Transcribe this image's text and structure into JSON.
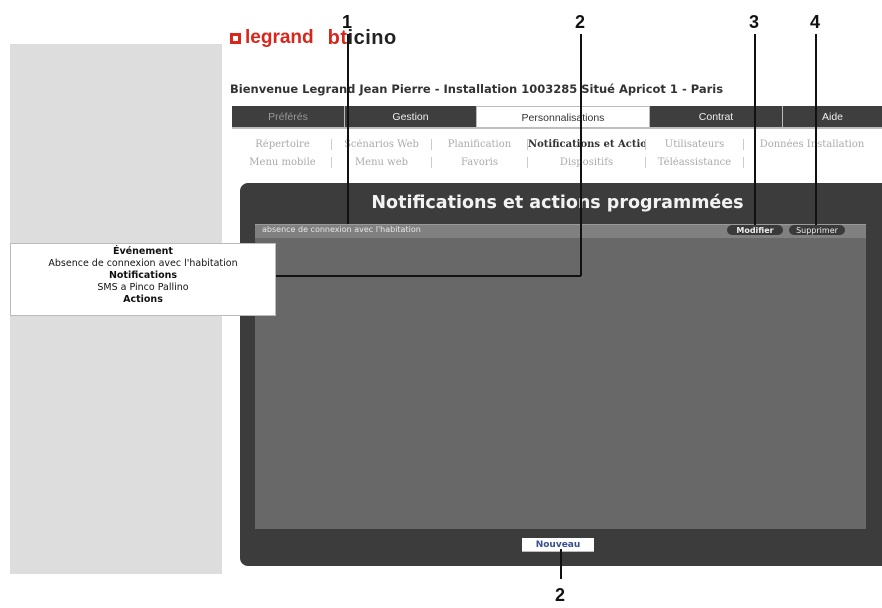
{
  "brand": {
    "legrand": "legrand",
    "bticino": "bticino"
  },
  "welcome": "Bienvenue Legrand Jean Pierre - Installation 1003285 Situé Apricot 1 - Paris",
  "main_tabs": [
    {
      "label": "Préférés"
    },
    {
      "label": "Gestion"
    },
    {
      "label": "Personnalisations"
    },
    {
      "label": "Contrat"
    },
    {
      "label": "Aide"
    }
  ],
  "subtabs_row1": [
    {
      "label": "Répertoire"
    },
    {
      "label": "Scénarios Web"
    },
    {
      "label": "Planification"
    },
    {
      "label": "Notifications et Actions"
    },
    {
      "label": "Utilisateurs"
    },
    {
      "label": "Données Installation"
    }
  ],
  "subtabs_row2": [
    {
      "label": "Menu mobile"
    },
    {
      "label": "Menu web"
    },
    {
      "label": "Favoris"
    },
    {
      "label": "Dispositifs"
    },
    {
      "label": "Téléassistance"
    }
  ],
  "panel": {
    "title": "Notifications et actions programmées",
    "row_label": "absence de connexion avec l'habitation",
    "modify": "Modifier",
    "delete": "Supprimer",
    "new": "Nouveau"
  },
  "tooltip": {
    "event_heading": "Événement",
    "event_value": "Absence de connexion avec l'habitation",
    "notifications_heading": "Notifications",
    "notifications_value": "SMS a Pinco Pallino",
    "actions_heading": "Actions"
  },
  "callouts": [
    "1",
    "2",
    "3",
    "4",
    "2"
  ],
  "colors": {
    "brand_red": "#d8261b",
    "panel_dark": "#3c3c3c",
    "panel_inner": "#686868",
    "new_button_text": "#3a4f8e"
  }
}
